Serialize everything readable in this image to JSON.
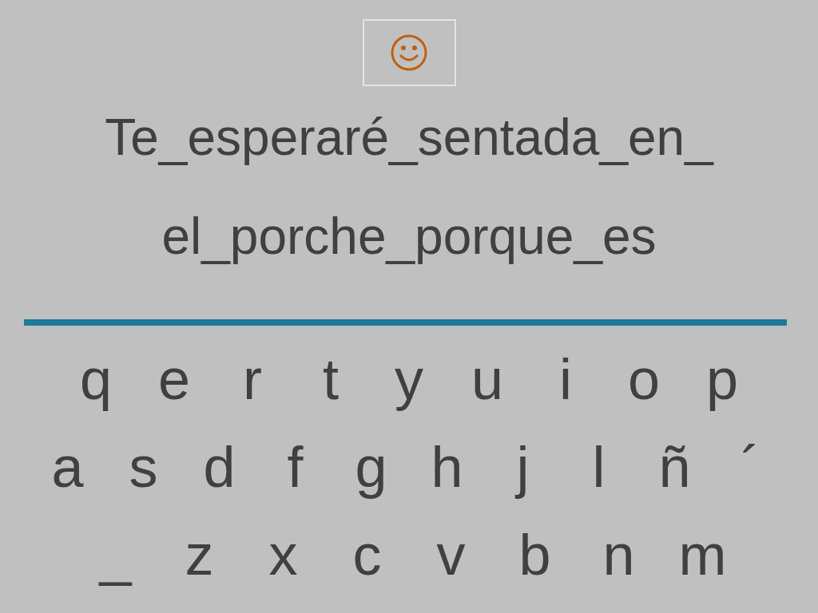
{
  "phrase_lines": [
    "Te_esperaré_sentada_en_",
    "el_porche_porque_es"
  ],
  "keyboard_rows": [
    [
      "q",
      "e",
      "r",
      "t",
      "y",
      "u",
      "i",
      "o",
      "p"
    ],
    [
      "a",
      "s",
      "d",
      "f",
      "g",
      "h",
      "j",
      "l",
      "ñ",
      "´"
    ],
    [
      "_",
      "z",
      "x",
      "c",
      "v",
      "b",
      "n",
      "m"
    ]
  ]
}
